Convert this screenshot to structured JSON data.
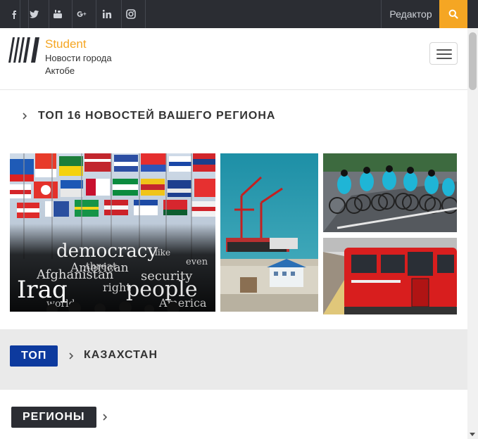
{
  "topbar": {
    "social": [
      {
        "name": "facebook-icon"
      },
      {
        "name": "twitter-icon"
      },
      {
        "name": "youtube-icon"
      },
      {
        "name": "google-plus-icon"
      },
      {
        "name": "linkedin-icon"
      },
      {
        "name": "instagram-icon"
      }
    ],
    "editor_label": "Редактор",
    "search_icon": "search-icon"
  },
  "header": {
    "brand": "Student",
    "tagline": "Новости города Актобе"
  },
  "top_section": {
    "title": "ТОП 16 НОВОСТЕЙ ВАШЕГО РЕГИОНА",
    "tiles": [
      {
        "name": "tile-democracy-flags",
        "words": [
          "democracy",
          "American",
          "Afghanistan",
          "Iraq",
          "people",
          "security",
          "threat",
          "right"
        ]
      },
      {
        "name": "tile-port-cranes"
      },
      {
        "name": "tile-cyclists"
      },
      {
        "name": "tile-red-train"
      }
    ]
  },
  "category_bar": {
    "badge": "ТОП",
    "label": "КАЗАХСТАН"
  },
  "regions_bar": {
    "badge": "РЕГИОНЫ"
  },
  "colors": {
    "topbar": "#2b2d33",
    "accent": "#f5a623",
    "badge_blue": "#0d3a9e",
    "badge_dark": "#2b2d33"
  }
}
